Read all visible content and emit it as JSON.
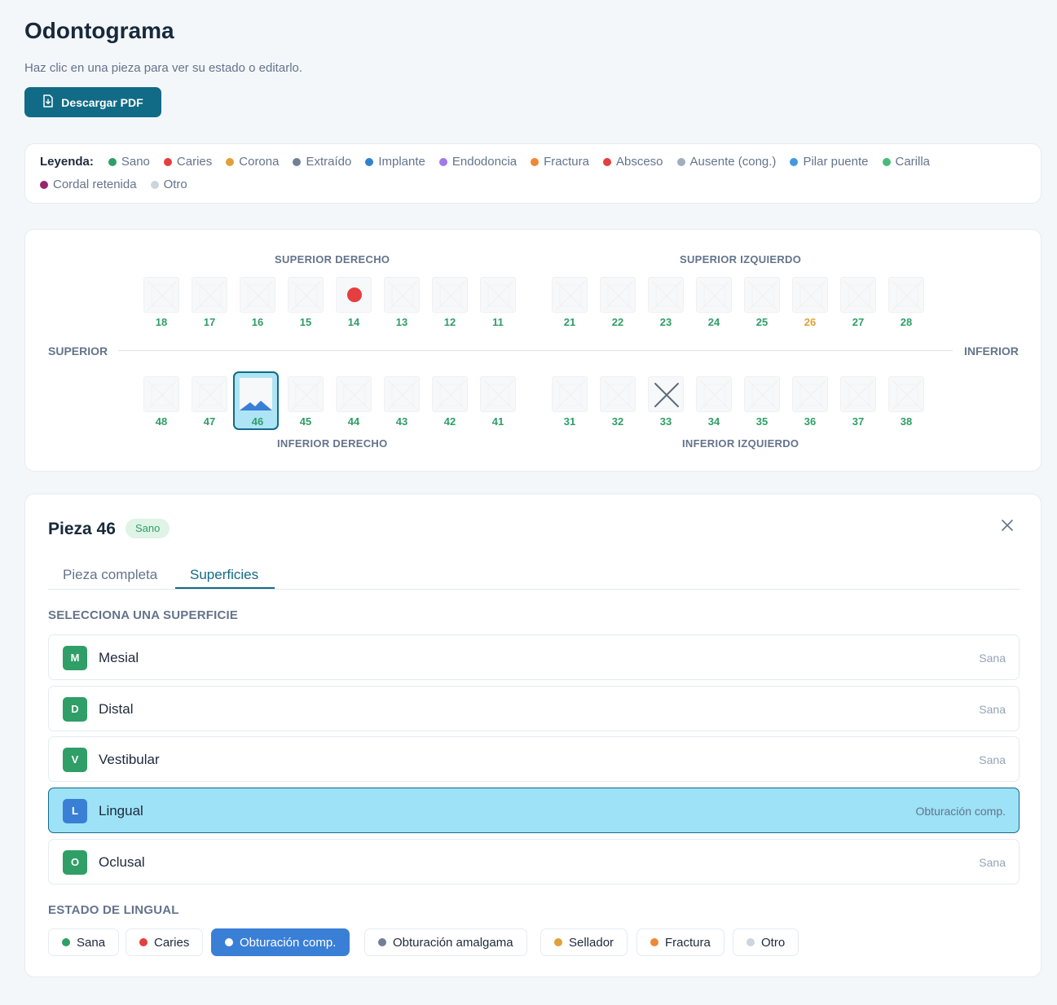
{
  "page": {
    "title": "Odontograma",
    "subtitle": "Haz clic en una pieza para ver su estado o editarlo.",
    "pdf_button": "Descargar PDF"
  },
  "legend": {
    "title": "Leyenda:",
    "items": [
      {
        "label": "Sano",
        "color": "#2f9e67"
      },
      {
        "label": "Caries",
        "color": "#e53e3e"
      },
      {
        "label": "Corona",
        "color": "#e0a13a"
      },
      {
        "label": "Extraído",
        "color": "#718096"
      },
      {
        "label": "Implante",
        "color": "#3182ce"
      },
      {
        "label": "Endodoncia",
        "color": "#9f7aea"
      },
      {
        "label": "Fractura",
        "color": "#ed8936"
      },
      {
        "label": "Absceso",
        "color": "#e53e3e"
      },
      {
        "label": "Ausente (cong.)",
        "color": "#a0aec0"
      },
      {
        "label": "Pilar puente",
        "color": "#4299e1"
      },
      {
        "label": "Carilla",
        "color": "#48bb78"
      },
      {
        "label": "Cordal retenida",
        "color": "#97266d"
      },
      {
        "label": "Otro",
        "color": "#cbd5e0"
      }
    ]
  },
  "chart": {
    "upper_right_label": "SUPERIOR DERECHO",
    "upper_left_label": "SUPERIOR IZQUIERDO",
    "lower_right_label": "INFERIOR DERECHO",
    "lower_left_label": "INFERIOR IZQUIERDO",
    "upper_side_label": "SUPERIOR",
    "lower_side_label": "INFERIOR",
    "upper_right": [
      {
        "num": "18"
      },
      {
        "num": "17"
      },
      {
        "num": "16"
      },
      {
        "num": "15"
      },
      {
        "num": "14",
        "mark": "caries"
      },
      {
        "num": "13"
      },
      {
        "num": "12"
      },
      {
        "num": "11"
      }
    ],
    "upper_left": [
      {
        "num": "21"
      },
      {
        "num": "22"
      },
      {
        "num": "23"
      },
      {
        "num": "24"
      },
      {
        "num": "25"
      },
      {
        "num": "26",
        "num_color": "#e0a13a"
      },
      {
        "num": "27"
      },
      {
        "num": "28"
      }
    ],
    "lower_right": [
      {
        "num": "48"
      },
      {
        "num": "47"
      },
      {
        "num": "46",
        "selected": true
      },
      {
        "num": "45"
      },
      {
        "num": "44"
      },
      {
        "num": "43"
      },
      {
        "num": "42"
      },
      {
        "num": "41"
      }
    ],
    "lower_left": [
      {
        "num": "31"
      },
      {
        "num": "32"
      },
      {
        "num": "33",
        "mark": "extracted"
      },
      {
        "num": "34"
      },
      {
        "num": "35"
      },
      {
        "num": "36"
      },
      {
        "num": "37"
      },
      {
        "num": "38"
      }
    ]
  },
  "detail": {
    "title": "Pieza 46",
    "badge": "Sano",
    "tabs": [
      "Pieza completa",
      "Superficies"
    ],
    "active_tab": 1,
    "select_label": "SELECCIONA UNA SUPERFICIE",
    "surfaces": [
      {
        "key": "M",
        "name": "Mesial",
        "state": "Sana"
      },
      {
        "key": "D",
        "name": "Distal",
        "state": "Sana"
      },
      {
        "key": "V",
        "name": "Vestibular",
        "state": "Sana"
      },
      {
        "key": "L",
        "name": "Lingual",
        "state": "Obturación comp.",
        "selected": true
      },
      {
        "key": "O",
        "name": "Oclusal",
        "state": "Sana"
      }
    ],
    "state_label": "ESTADO DE LINGUAL",
    "states": [
      {
        "label": "Sana",
        "color": "#2f9e67"
      },
      {
        "label": "Caries",
        "color": "#e53e3e"
      },
      {
        "label": "Obturación comp.",
        "color": "#ffffff",
        "active": true
      },
      {
        "label": "Obturación amalgama",
        "color": "#718096"
      },
      {
        "label": "Sellador",
        "color": "#e0a13a"
      },
      {
        "label": "Fractura",
        "color": "#ed8936"
      },
      {
        "label": "Otro",
        "color": "#cbd5e0"
      }
    ]
  }
}
